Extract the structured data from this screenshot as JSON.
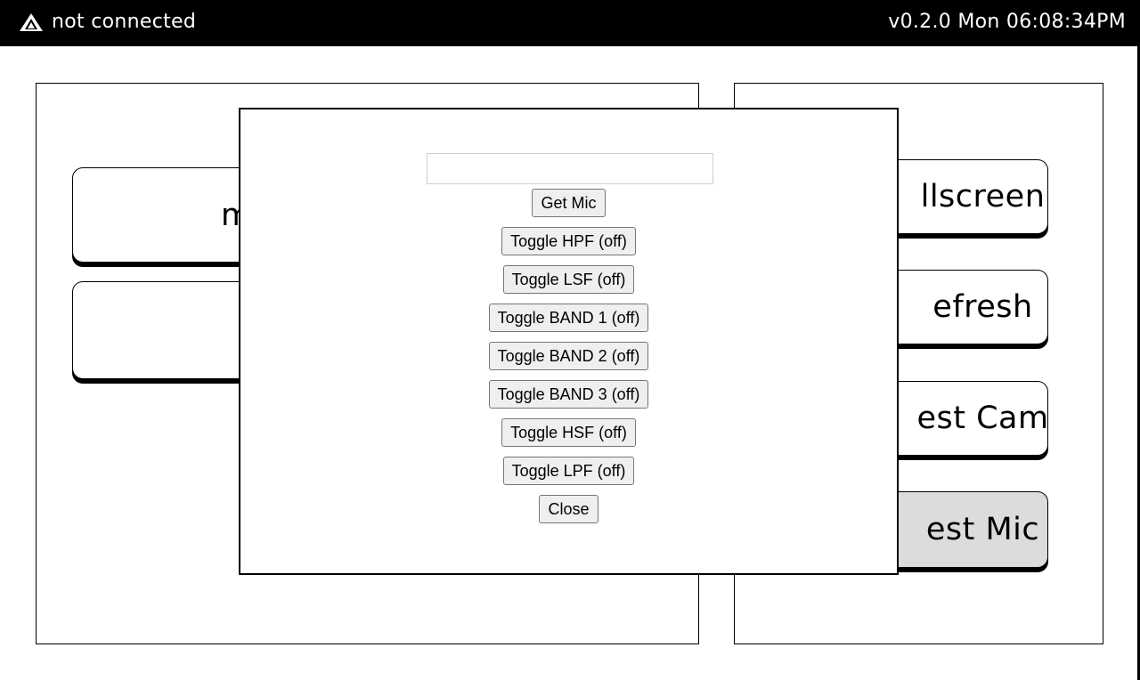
{
  "topbar": {
    "status_text": "not connected",
    "status_icon": "warning-triangle-icon",
    "clock_text": "v0.2.0 Mon 06:08:34PM"
  },
  "left_panel": {
    "buttons": [
      {
        "label": "m"
      },
      {
        "label": ""
      }
    ]
  },
  "right_panel": {
    "buttons": [
      {
        "label": "llscreen"
      },
      {
        "label": "efresh"
      },
      {
        "label": "est Cam"
      },
      {
        "label": "est Mic",
        "active": true
      }
    ]
  },
  "modal": {
    "input_value": "",
    "buttons": [
      {
        "label": "Get Mic"
      },
      {
        "label": "Toggle HPF (off)"
      },
      {
        "label": "Toggle LSF (off)"
      },
      {
        "label": "Toggle BAND 1 (off)"
      },
      {
        "label": "Toggle BAND 2 (off)"
      },
      {
        "label": "Toggle BAND 3 (off)"
      },
      {
        "label": "Toggle HSF (off)"
      },
      {
        "label": "Toggle LPF (off)"
      },
      {
        "label": "Close"
      }
    ]
  },
  "colors": {
    "topbar_bg": "#000000",
    "active_button_bg": "#dcdcdc"
  }
}
